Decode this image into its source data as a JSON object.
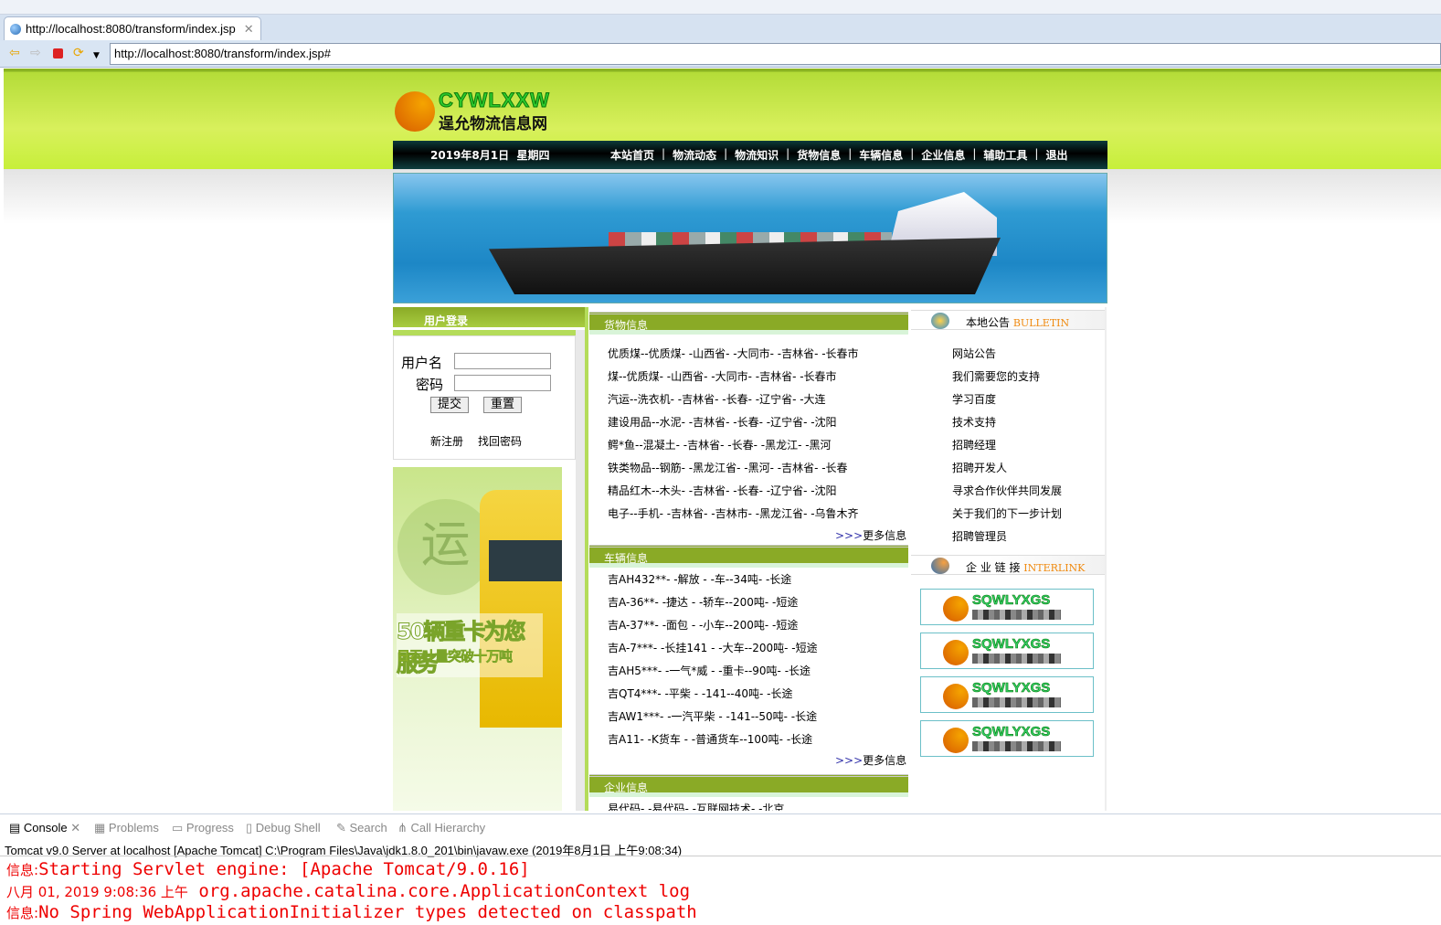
{
  "browser": {
    "tab_title": "http://localhost:8080/transform/index.jsp",
    "url": "http://localhost:8080/transform/index.jsp#"
  },
  "site": {
    "logo_en": "CYWLXXW",
    "logo_cn": "逞允物流信息网",
    "date": "2019年8月1日  星期四",
    "nav": [
      "本站首页",
      "物流动态",
      "物流知识",
      "货物信息",
      "车辆信息",
      "企业信息",
      "辅助工具",
      "退出"
    ],
    "login": {
      "title": "用户登录",
      "username_label": "用户名",
      "password_label": "密码",
      "username_value": "",
      "password_value": "",
      "submit": "提交",
      "reset": "重置",
      "register": "新注册",
      "recover": "找回密码"
    },
    "ad": {
      "char": "运",
      "slogan1": "50辆重卡为您服务",
      "slogan2": "日吞吐量突破十万吨"
    },
    "cargo": {
      "title": "货物信息",
      "items": [
        "优质煤--优质煤- -山西省- -大同市- -吉林省- -长春市",
        "煤--优质煤- -山西省- -大同市- -吉林省- -长春市",
        "汽运--洗衣机- -吉林省- -长春- -辽宁省- -大连",
        "建设用品--水泥- -吉林省- -长春- -辽宁省- -沈阳",
        "鳄*鱼--混凝土- -吉林省- -长春- -黑龙江- -黑河",
        "铁类物品--钢筋- -黑龙江省- -黑河- -吉林省- -长春",
        "精品红木--木头- -吉林省- -长春- -辽宁省- -沈阳",
        "电子--手机- -吉林省- -吉林市- -黑龙江省- -乌鲁木齐"
      ],
      "more": "更多信息",
      "more_prefix": ">>>"
    },
    "vehicle": {
      "title": "车辆信息",
      "items": [
        "吉AH432**- -解放 - -车--34吨- -长途",
        "吉A-36**- -捷达 - -轿车--200吨- -短途",
        "吉A-37**- -面包 - -小车--200吨- -短途",
        "吉A-7***- -长挂141 - -大车--200吨- -短途",
        "吉AH5***- -一气*威 - -重卡--90吨- -长途",
        "吉QT4***- -平柴 - -141--40吨- -长途",
        "吉AW1***- -一汽平柴 - -141--50吨- -长途",
        "吉A11- -K货车 - -普通货车--100吨- -长途"
      ],
      "more": "更多信息",
      "more_prefix": ">>>"
    },
    "enterprise": {
      "title": "企业信息",
      "items": [
        "易代码- -易代码- -互联网技术- -北京"
      ]
    },
    "bulletin": {
      "title": "本地公告",
      "title_en": "BULLETIN",
      "items": [
        "网站公告",
        "我们需要您的支持",
        "学习百度",
        "技术支持",
        "招聘经理",
        "招聘开发人",
        "寻求合作伙伴共同发展",
        "关于我们的下一步计划",
        "招聘管理员"
      ]
    },
    "interlink": {
      "title": "企 业 链 接",
      "title_en": "INTERLINK",
      "links": [
        "SQWLYXGS",
        "SQWLYXGS",
        "SQWLYXGS",
        "SQWLYXGS"
      ]
    }
  },
  "console": {
    "tabs": [
      "Console",
      "Problems",
      "Progress",
      "Debug Shell",
      "Search",
      "Call Hierarchy"
    ],
    "info": "Tomcat v9.0 Server at localhost [Apache Tomcat] C:\\Program Files\\Java\\jdk1.8.0_201\\bin\\javaw.exe (2019年8月1日 上午9:08:34)",
    "lines": [
      {
        "prefix": "信息:",
        "text": "Starting Servlet engine: [Apache Tomcat/9.0.16]"
      },
      {
        "prefix": "八月 01, 2019 9:08:36 上午",
        "text": "org.apache.catalina.core.ApplicationContext log"
      },
      {
        "prefix": "信息:",
        "text": "No Spring WebApplicationInitializer types detected on classpath"
      }
    ]
  }
}
